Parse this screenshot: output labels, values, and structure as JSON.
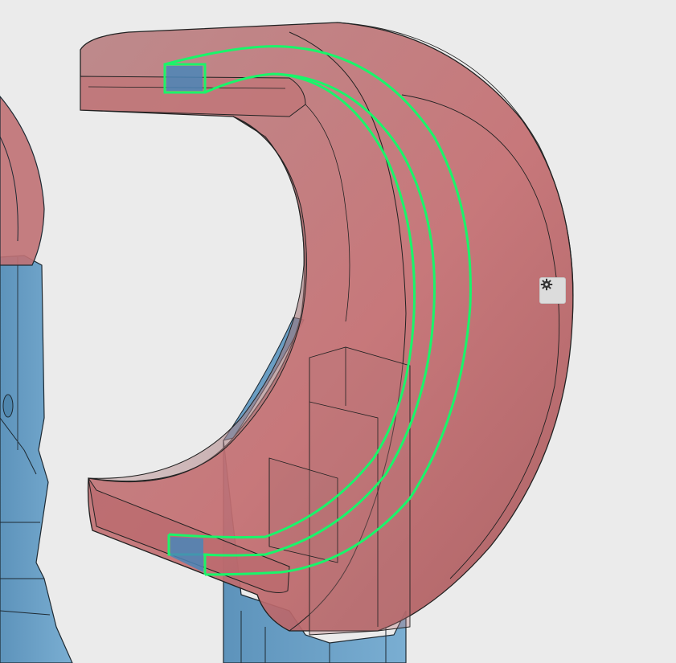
{
  "viewport": {
    "background": "#ebebeb",
    "parts": [
      {
        "name": "red-part",
        "color": "#c8666a",
        "transparent": true
      },
      {
        "name": "blue-part",
        "color": "#6a9ec4",
        "transparent": true
      }
    ],
    "selection_color": "#19f56a"
  },
  "controls": {
    "settings_icon": "gear-icon"
  }
}
